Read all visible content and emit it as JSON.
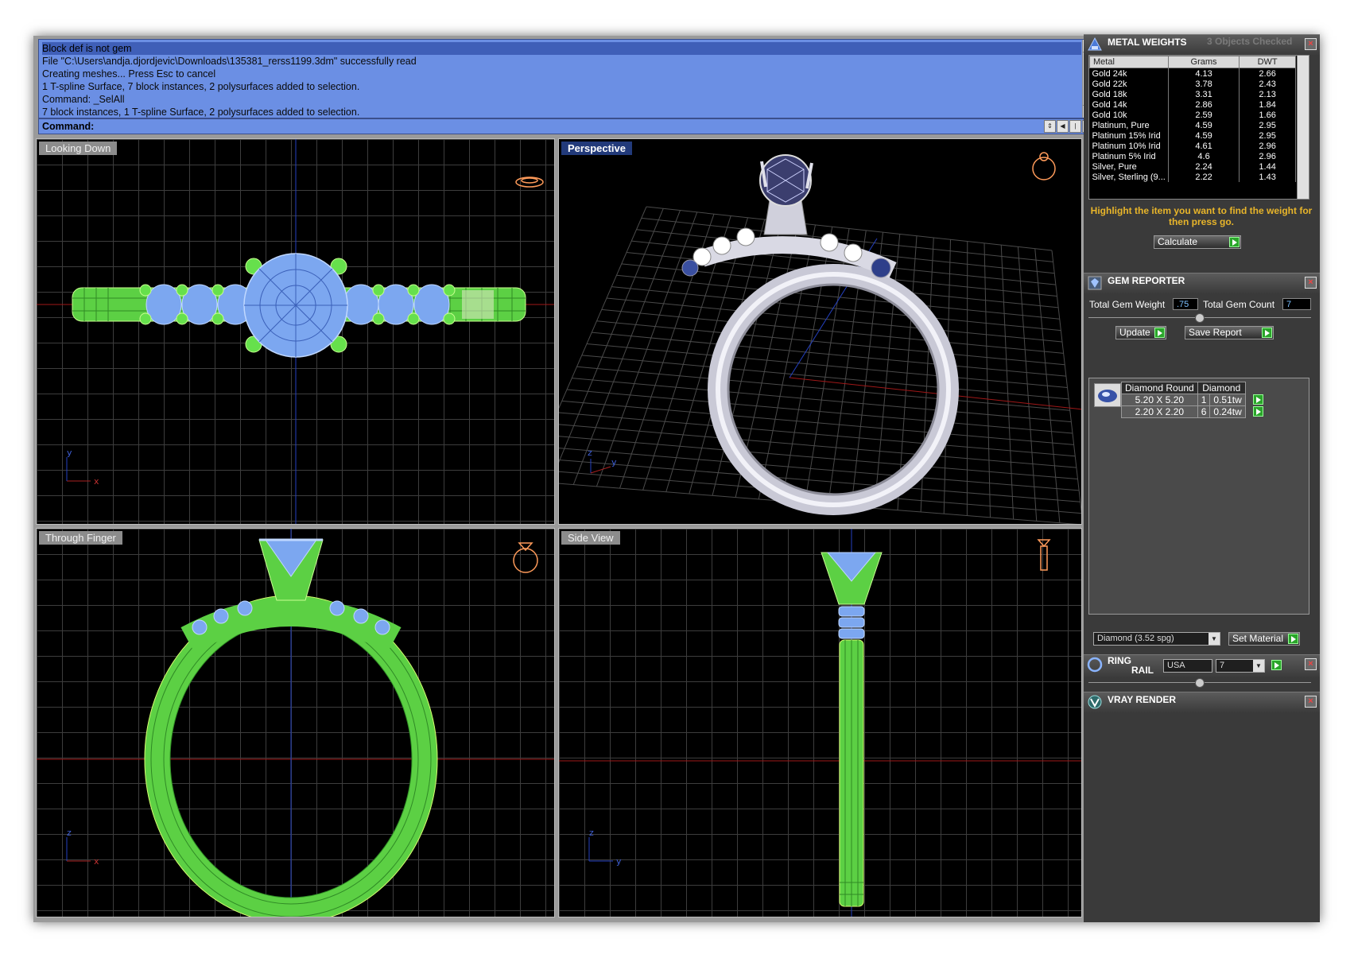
{
  "command_history": [
    "Block def is not gem",
    "File \"C:\\Users\\andja.djordjevic\\Downloads\\135381_rerss1199.3dm\" successfully read",
    "Creating meshes... Press Esc to cancel",
    "1 T-spline Surface, 7 block instances, 2 polysurfaces added to selection.",
    "Command: _SelAll",
    "7 block instances, 1 T-spline Surface, 2 polysurfaces added to selection."
  ],
  "command_prompt": "Command:",
  "viewports": {
    "top_left": {
      "label": "Looking Down",
      "axis_a": "y",
      "axis_b": "x"
    },
    "top_right": {
      "label": "Perspective",
      "axis_a": "z",
      "axis_b": "y"
    },
    "bottom_left": {
      "label": "Through Finger",
      "axis_a": "z",
      "axis_b": "x"
    },
    "bottom_right": {
      "label": "Side View",
      "axis_a": "z",
      "axis_b": "y"
    }
  },
  "metal_weights": {
    "title": "METAL WEIGHTS",
    "status": "3 Objects Checked",
    "columns": [
      "Metal",
      "Grams",
      "DWT"
    ],
    "rows": [
      [
        "Gold 24k",
        "4.13",
        "2.66"
      ],
      [
        "Gold 22k",
        "3.78",
        "2.43"
      ],
      [
        "Gold 18k",
        "3.31",
        "2.13"
      ],
      [
        "Gold 14k",
        "2.86",
        "1.84"
      ],
      [
        "Gold 10k",
        "2.59",
        "1.66"
      ],
      [
        "Platinum, Pure",
        "4.59",
        "2.95"
      ],
      [
        "Platinum 15% Irid",
        "4.59",
        "2.95"
      ],
      [
        "Platinum 10% Irid",
        "4.61",
        "2.96"
      ],
      [
        "Platinum 5% Irid",
        "4.6",
        "2.96"
      ],
      [
        "Silver, Pure",
        "2.24",
        "1.44"
      ],
      [
        "Silver, Sterling (9...",
        "2.22",
        "1.43"
      ]
    ],
    "hint": "Highlight the item you want to find the weight for then press go.",
    "calculate_label": "Calculate"
  },
  "gem_reporter": {
    "title": "GEM REPORTER",
    "total_weight_label": "Total Gem Weight",
    "total_weight": ".75",
    "total_count_label": "Total Gem Count",
    "total_count": "7",
    "update_label": "Update",
    "save_report_label": "Save Report",
    "columns": [
      "Diamond Round",
      "Diamond"
    ],
    "rows": [
      [
        "5.20 X 5.20",
        "1",
        "0.51tw"
      ],
      [
        "2.20 X 2.20",
        "6",
        "0.24tw"
      ]
    ],
    "material_value": "Diamond     (3.52 spg)",
    "set_material_label": "Set Material"
  },
  "ring_rail": {
    "title_line1": "RING",
    "title_line2": "RAIL",
    "region": "USA",
    "size": "7"
  },
  "vray_render": {
    "title": "VRAY RENDER"
  },
  "colors": {
    "command_bg": "#6b8fe4",
    "wireframe_green": "#66e04c",
    "gem_blue": "#7ca7f0",
    "grid": "#3d3d3d",
    "hint_text": "#e8b52a"
  }
}
